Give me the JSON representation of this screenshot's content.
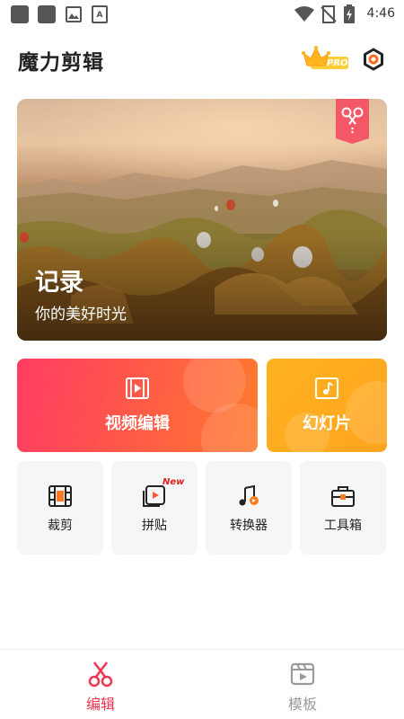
{
  "status_bar": {
    "time": "4:46",
    "left_icons": [
      "app-icon",
      "app-icon",
      "image-icon",
      "font-icon"
    ],
    "right_icons": [
      "wifi-icon",
      "no-signal-icon",
      "battery-charging-icon"
    ]
  },
  "header": {
    "title": "魔力剪辑",
    "pro_badge": "PRO",
    "settings_icon": "settings-icon"
  },
  "hero": {
    "title": "记录",
    "subtitle": "你的美好时光",
    "tag_icon": "scissors-icon"
  },
  "main_cards": [
    {
      "label": "视频编辑",
      "icon": "film-icon",
      "color": "#ff4a55"
    },
    {
      "label": "幻灯片",
      "icon": "music-note-icon",
      "color": "#ffab1f"
    }
  ],
  "tools": [
    {
      "label": "裁剪",
      "icon": "crop-film-icon",
      "badge": ""
    },
    {
      "label": "拼贴",
      "icon": "collage-icon",
      "badge": "New"
    },
    {
      "label": "转换器",
      "icon": "music-convert-icon",
      "badge": ""
    },
    {
      "label": "工具箱",
      "icon": "toolbox-icon",
      "badge": ""
    }
  ],
  "bottom_nav": [
    {
      "label": "编辑",
      "icon": "scissors-icon",
      "active": true,
      "color": "#f0354f"
    },
    {
      "label": "模板",
      "icon": "template-film-icon",
      "active": false,
      "color": "#9a9a9a"
    }
  ]
}
